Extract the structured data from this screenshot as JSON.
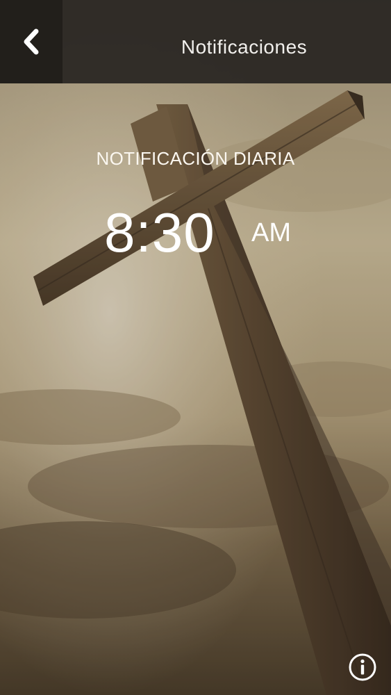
{
  "header": {
    "back_icon": "chevron-left-icon",
    "title": "Notificaciones"
  },
  "notification": {
    "label": "NOTIFICACIÓN DIARIA",
    "time": "8:30",
    "ampm": "AM"
  },
  "footer": {
    "info_icon": "info-icon"
  },
  "colors": {
    "header_bg": "#2a2622",
    "back_bg": "#221f1c",
    "text": "#ffffff",
    "sky": "#c9b68f",
    "wood": "#5a4632"
  }
}
